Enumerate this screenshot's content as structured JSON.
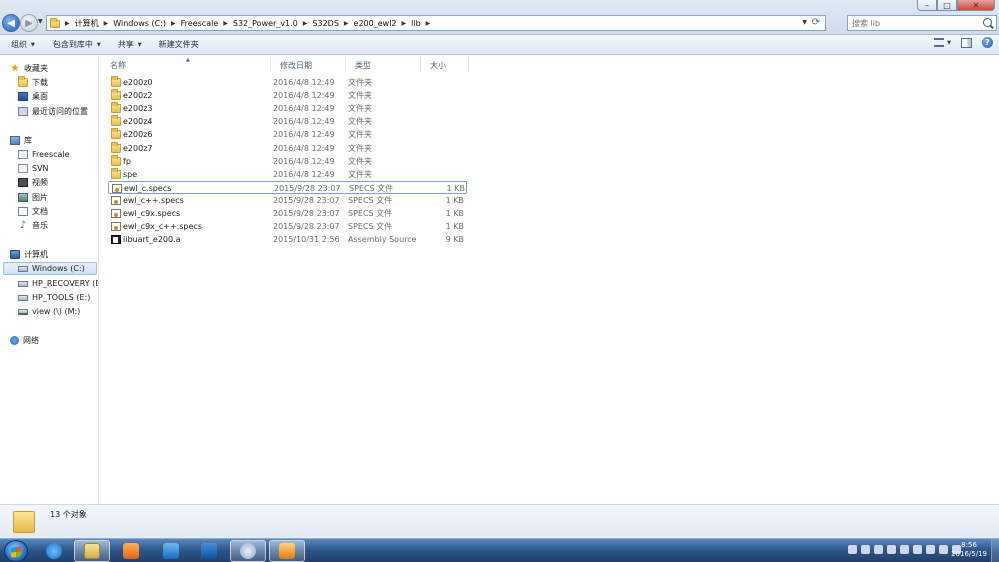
{
  "breadcrumbs": [
    "计算机",
    "Windows (C:)",
    "Freescale",
    "S32_Power_v1.0",
    "S32DS",
    "e200_ewl2",
    "lib"
  ],
  "search": {
    "placeholder": "搜索 lib"
  },
  "toolbar": {
    "organize": "组织",
    "include_in_library": "包含到库中",
    "share": "共享",
    "new_folder": "新建文件夹"
  },
  "nav": {
    "favorites": "收藏夹",
    "downloads": "下载",
    "desktop": "桌面",
    "recent_places": "最近访问的位置",
    "libraries": "库",
    "lib_freescale": "Freescale",
    "lib_svn": "SVN",
    "lib_videos": "视频",
    "lib_pictures": "图片",
    "lib_documents": "文档",
    "lib_music": "音乐",
    "computer": "计算机",
    "drive_c": "Windows (C:)",
    "drive_d": "HP_RECOVERY (D:)",
    "drive_e": "HP_TOOLS (E:)",
    "drive_m": "view (\\) (M:)",
    "network": "网络"
  },
  "columns": {
    "name": "名称",
    "date": "修改日期",
    "type": "类型",
    "size": "大小"
  },
  "files": [
    {
      "name": "e200z0",
      "date": "2016/4/8 12:49",
      "type": "文件夹",
      "size": "",
      "icon": "folder-icon"
    },
    {
      "name": "e200z2",
      "date": "2016/4/8 12:49",
      "type": "文件夹",
      "size": "",
      "icon": "folder-icon"
    },
    {
      "name": "e200z3",
      "date": "2016/4/8 12:49",
      "type": "文件夹",
      "size": "",
      "icon": "folder-icon"
    },
    {
      "name": "e200z4",
      "date": "2016/4/8 12:49",
      "type": "文件夹",
      "size": "",
      "icon": "folder-icon"
    },
    {
      "name": "e200z6",
      "date": "2016/4/8 12:49",
      "type": "文件夹",
      "size": "",
      "icon": "folder-icon"
    },
    {
      "name": "e200z7",
      "date": "2016/4/8 12:49",
      "type": "文件夹",
      "size": "",
      "icon": "folder-icon"
    },
    {
      "name": "fp",
      "date": "2016/4/8 12:49",
      "type": "文件夹",
      "size": "",
      "icon": "folder-icon"
    },
    {
      "name": "spe",
      "date": "2016/4/8 12:49",
      "type": "文件夹",
      "size": "",
      "icon": "folder-icon"
    },
    {
      "name": "ewl_c.specs",
      "date": "2015/9/28 23:07",
      "type": "SPECS 文件",
      "size": "1 KB",
      "icon": "specs-file-icon"
    },
    {
      "name": "ewl_c++.specs",
      "date": "2015/9/28 23:07",
      "type": "SPECS 文件",
      "size": "1 KB",
      "icon": "specs-file-icon"
    },
    {
      "name": "ewl_c9x.specs",
      "date": "2015/9/28 23:07",
      "type": "SPECS 文件",
      "size": "1 KB",
      "icon": "specs-file-icon"
    },
    {
      "name": "ewl_c9x_c++.specs",
      "date": "2015/9/28 23:07",
      "type": "SPECS 文件",
      "size": "1 KB",
      "icon": "specs-file-icon"
    },
    {
      "name": "libuart_e200.a",
      "date": "2015/10/31 2:56",
      "type": "Assembly Source",
      "size": "9 KB",
      "icon": "assembly-file-icon"
    }
  ],
  "status": {
    "count": "13 个对象"
  },
  "taskbar": {
    "time": "8:56",
    "date": "2016/5/19",
    "apps": [
      "internet-explorer-icon",
      "explorer-icon",
      "media-player-icon",
      "qq-icon",
      "outlook-icon",
      "browser-icon",
      "s32-design-studio-icon"
    ]
  },
  "colors": {
    "accent": "#2c5589",
    "selection": "#cfe2f7"
  }
}
